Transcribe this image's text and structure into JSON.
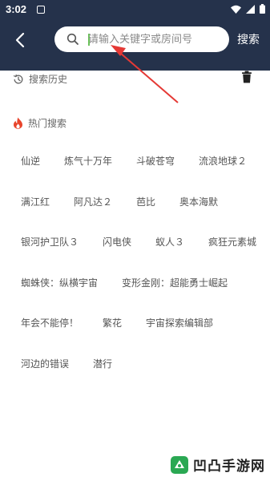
{
  "status_bar": {
    "time": "3:02",
    "icons": [
      "notification-icon",
      "wifi-icon",
      "signal-icon",
      "battery-icon"
    ]
  },
  "header": {
    "back_icon": "arrow-left-icon",
    "search_placeholder": "请输入关键字或房间号",
    "search_button": "搜索"
  },
  "history": {
    "title": "搜索历史",
    "icon": "history-icon",
    "clear_icon": "trash-icon"
  },
  "hot": {
    "title": "热门搜索",
    "icon": "fire-icon",
    "rows": [
      [
        "仙逆",
        "炼气十万年",
        "斗破苍穹",
        "流浪地球２"
      ],
      [
        "满江红",
        "阿凡达２",
        "芭比",
        "奥本海默"
      ],
      [
        "银河护卫队３",
        "闪电侠",
        "蚁人３",
        "疯狂元素城"
      ],
      [
        "蜘蛛侠：纵横宇宙",
        "变形金刚：超能勇士崛起"
      ],
      [
        "年会不能停！",
        "繁花",
        "宇宙探索编辑部"
      ],
      [
        "河边的错误",
        "潜行"
      ]
    ]
  },
  "watermark": {
    "text": "凹凸手游网"
  },
  "colors": {
    "header_bg": "#25324b",
    "accent_fire": "#e8452c",
    "arrow": "#e53935"
  }
}
